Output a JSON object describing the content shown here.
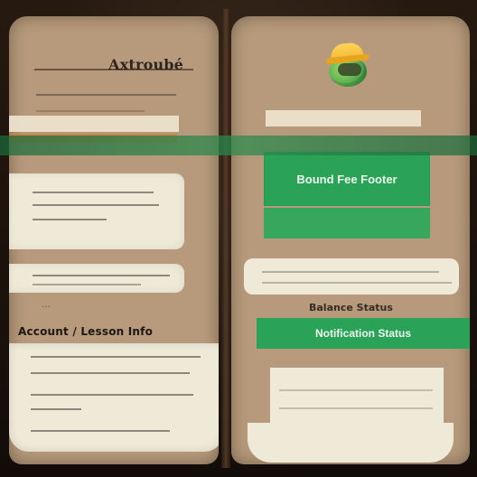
{
  "left_page": {
    "title": "Axtroubé",
    "faint_label": "…",
    "heading": "Account / Lesson Info"
  },
  "right_page": {
    "primary_button_label": "Bound Fee Footer",
    "section_label": "Balance Status",
    "status_button_label": "Notification Status"
  },
  "icons": {
    "avatar": "green-character-avatar-icon"
  }
}
